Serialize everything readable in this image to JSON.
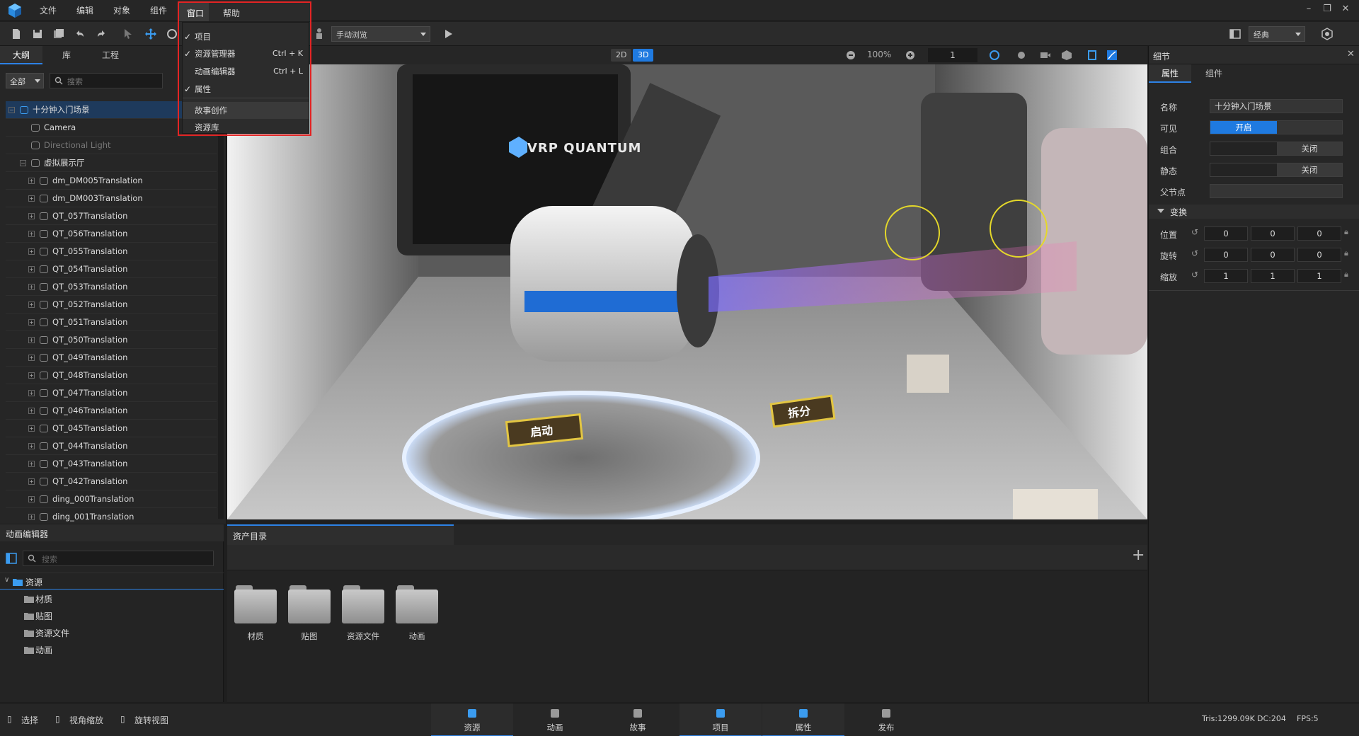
{
  "menubar": {
    "items": [
      "文件",
      "编辑",
      "对象",
      "组件",
      "窗口",
      "帮助"
    ]
  },
  "window_menu": {
    "items": [
      {
        "label": "项目",
        "checked": true,
        "shortcut": ""
      },
      {
        "label": "资源管理器",
        "checked": true,
        "shortcut": "Ctrl + K"
      },
      {
        "label": "动画编辑器",
        "checked": false,
        "shortcut": "Ctrl + L"
      },
      {
        "label": "属性",
        "checked": true,
        "shortcut": ""
      },
      {
        "label": "故事创作",
        "checked": false,
        "shortcut": ""
      },
      {
        "label": "资源库",
        "checked": false,
        "shortcut": ""
      }
    ]
  },
  "toolbar": {
    "nav_mode": "手动浏览",
    "layout": "经典"
  },
  "left_panel": {
    "tabs": [
      "大纲",
      "库",
      "工程"
    ],
    "filter": "全部",
    "search_placeholder": "搜索",
    "tree": [
      {
        "label": "十分钟入门场景",
        "level": 0
      },
      {
        "label": "Camera",
        "level": 1
      },
      {
        "label": "Directional Light",
        "level": 1
      },
      {
        "label": "虚拟展示厅",
        "level": 1
      },
      {
        "label": "dm_DM005Translation",
        "level": 2
      },
      {
        "label": "dm_DM003Translation",
        "level": 2
      },
      {
        "label": "QT_057Translation",
        "level": 2
      },
      {
        "label": "QT_056Translation",
        "level": 2
      },
      {
        "label": "QT_055Translation",
        "level": 2
      },
      {
        "label": "QT_054Translation",
        "level": 2
      },
      {
        "label": "QT_053Translation",
        "level": 2
      },
      {
        "label": "QT_052Translation",
        "level": 2
      },
      {
        "label": "QT_051Translation",
        "level": 2
      },
      {
        "label": "QT_050Translation",
        "level": 2
      },
      {
        "label": "QT_049Translation",
        "level": 2
      },
      {
        "label": "QT_048Translation",
        "level": 2
      },
      {
        "label": "QT_047Translation",
        "level": 2
      },
      {
        "label": "QT_046Translation",
        "level": 2
      },
      {
        "label": "QT_045Translation",
        "level": 2
      },
      {
        "label": "QT_044Translation",
        "level": 2
      },
      {
        "label": "QT_043Translation",
        "level": 2
      },
      {
        "label": "QT_042Translation",
        "level": 2
      },
      {
        "label": "ding_000Translation",
        "level": 2
      },
      {
        "label": "ding_001Translation",
        "level": 2
      }
    ]
  },
  "viewport": {
    "mode_2d": "2D",
    "mode_3d": "3D",
    "zoom": "100%",
    "frame": "1",
    "scene_logo_text": "VRP QUANTUM",
    "button_start": "启动",
    "button_split": "拆分"
  },
  "details": {
    "title": "细节",
    "tabs": [
      "属性",
      "组件"
    ],
    "name_label": "名称",
    "name_value": "十分钟入门场景",
    "visible_label": "可见",
    "visible_value": "开启",
    "group_label": "组合",
    "group_value": "关闭",
    "static_label": "静态",
    "static_value": "关闭",
    "parent_label": "父节点",
    "transform_label": "变换",
    "position_label": "位置",
    "rotation_label": "旋转",
    "scale_label": "缩放",
    "position": [
      "0",
      "0",
      "0"
    ],
    "rotation": [
      "0",
      "0",
      "0"
    ],
    "scale": [
      "1",
      "1",
      "1"
    ]
  },
  "anim_panel": {
    "title": "动画编辑器",
    "search_placeholder": "搜索",
    "root": "资源",
    "children": [
      "材质",
      "贴图",
      "资源文件",
      "动画"
    ]
  },
  "asset_panel": {
    "tab": "资产目录",
    "folders": [
      "材质",
      "贴图",
      "资源文件",
      "动画"
    ]
  },
  "statusbar": {
    "left": [
      "选择",
      "视角缩放",
      "旋转视图"
    ],
    "tabs": [
      "资源",
      "动画",
      "故事",
      "项目",
      "属性",
      "发布"
    ],
    "tris": "Tris:1299.09K",
    "dc": "DC:204",
    "fps": "FPS:5"
  },
  "colors": {
    "accent": "#2d82e6",
    "highlight_border": "#e32424",
    "toggle_on": "#1f7ae0"
  }
}
